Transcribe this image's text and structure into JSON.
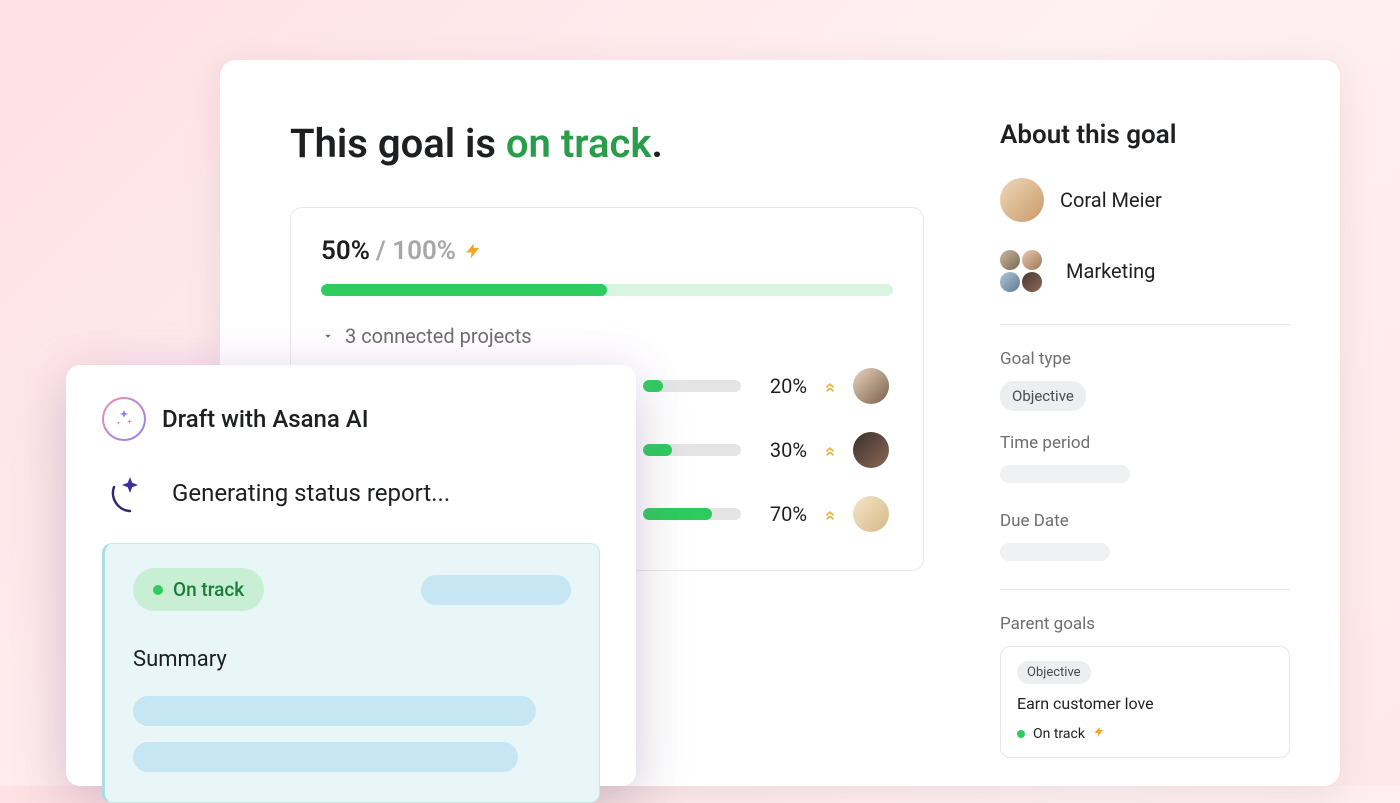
{
  "colors": {
    "green": "#2ecc5f",
    "blue_fill": "#c5e6f2",
    "bg_pink": "#ffe6e9"
  },
  "main": {
    "heading_prefix": "This goal is ",
    "heading_status": "on track",
    "heading_suffix": ".",
    "progress": {
      "current": "50%",
      "total": "/ 100%",
      "percent": 50
    },
    "connected_label": "3 connected projects",
    "projects": [
      {
        "percent_label": "20%",
        "percent": 20
      },
      {
        "percent_label": "30%",
        "percent": 30
      },
      {
        "percent_label": "70%",
        "percent": 70
      }
    ]
  },
  "sidebar": {
    "about_title": "About this goal",
    "owner_name": "Coral Meier",
    "team_name": "Marketing",
    "goal_type_label": "Goal type",
    "goal_type_value": "Objective",
    "time_period_label": "Time period",
    "due_date_label": "Due Date",
    "parent_goals_label": "Parent goals",
    "parent": {
      "pill": "Objective",
      "title": "Earn customer love",
      "status": "On track"
    }
  },
  "ai": {
    "title": "Draft with Asana AI",
    "generating": "Generating status report...",
    "status_pill": "On track",
    "summary_label": "Summary"
  }
}
